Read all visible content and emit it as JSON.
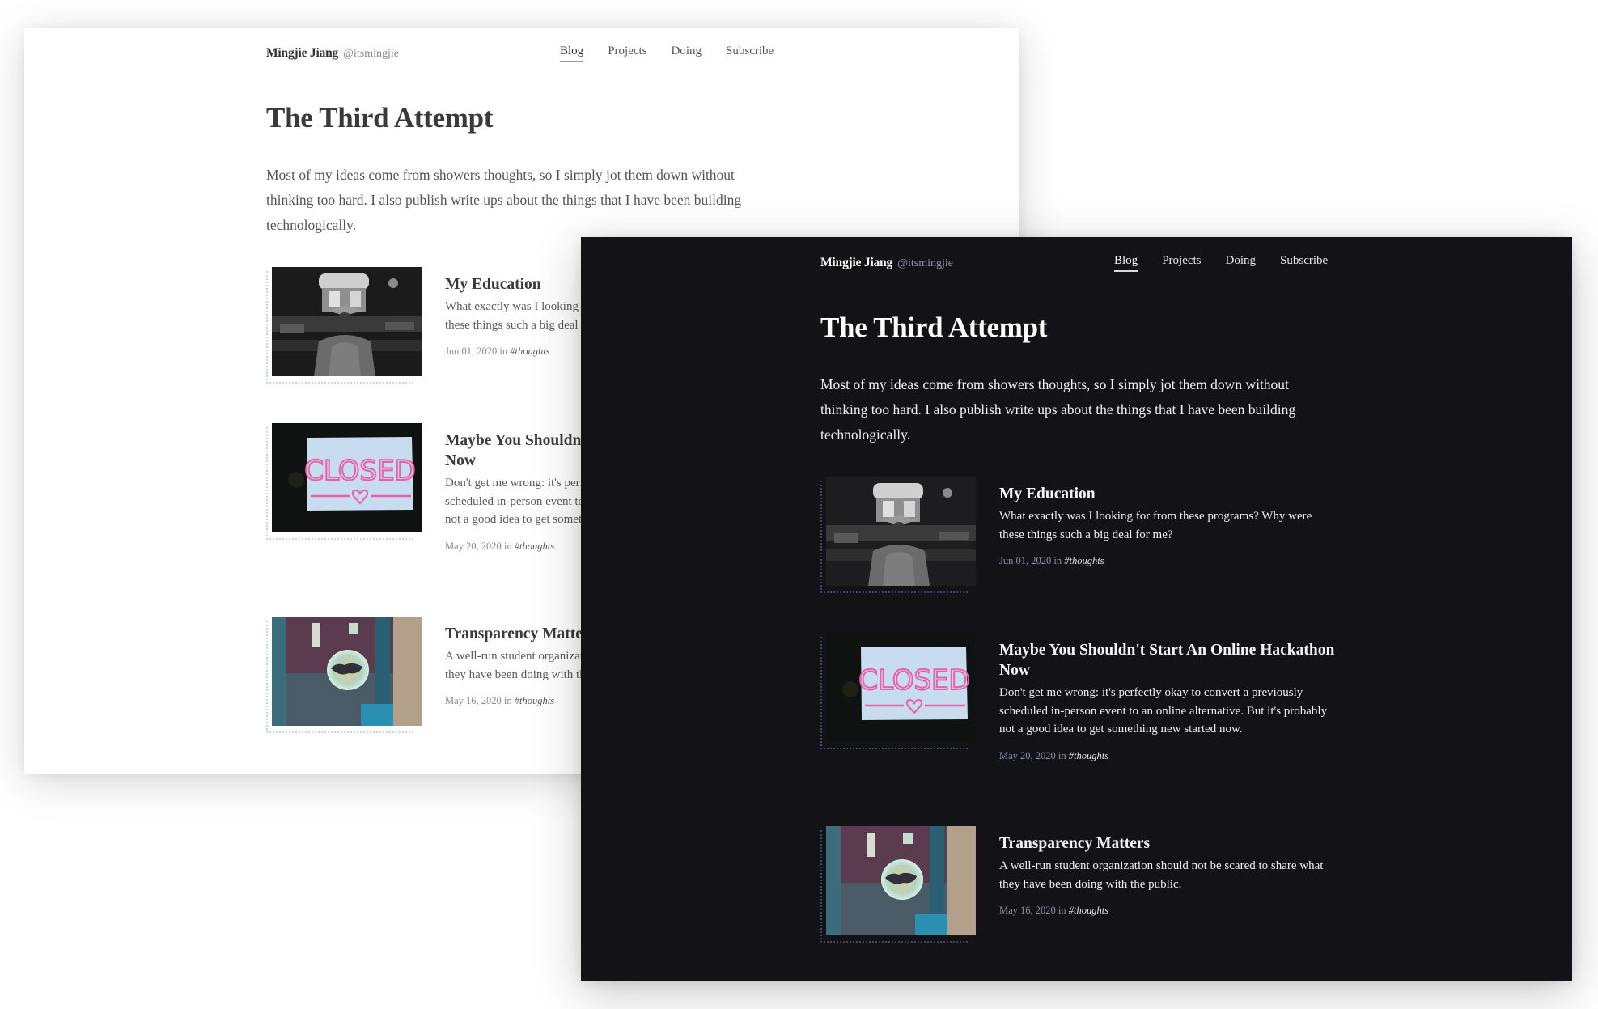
{
  "site": {
    "brand_name": "Mingjie Jiang",
    "brand_handle": "@itsmingjie",
    "nav": [
      {
        "label": "Blog",
        "active": true
      },
      {
        "label": "Projects",
        "active": false
      },
      {
        "label": "Doing",
        "active": false
      },
      {
        "label": "Subscribe",
        "active": false
      }
    ],
    "page_title": "The Third Attempt",
    "intro": "Most of my ideas come from showers thoughts, so I simply jot them down without thinking too hard. I also publish write ups about the things that I have been building technologically.",
    "posts": [
      {
        "title": "My Education",
        "excerpt": "What exactly was I looking for from these programs? Why were these things such a big deal for me?",
        "date": "Jun 01, 2020",
        "in_label": "in",
        "tag": "#thoughts",
        "image": "graduation-photo"
      },
      {
        "title": "Maybe You Shouldn't Start An Online Hackathon Now",
        "excerpt": "Don't get me wrong: it's perfectly okay to convert a previously scheduled in-person event to an online alternative. But it's probably not a good idea to get something new started now.",
        "date": "May 20, 2020",
        "in_label": "in",
        "tag": "#thoughts",
        "image": "closed-sign-photo",
        "image_text": "CLOSED"
      },
      {
        "title": "Transparency Matters",
        "excerpt": "A well-run student organization should not be scared to share what they have been doing with the public.",
        "date": "May 16, 2020",
        "in_label": "in",
        "tag": "#thoughts",
        "image": "bubble-photo"
      }
    ]
  },
  "themes": {
    "light": {
      "background": "#ffffff",
      "text": "#3a3a3a",
      "muted": "#8a8a8a"
    },
    "dark": {
      "background": "#131217",
      "text": "#ffffff",
      "muted": "#8a93a8"
    }
  }
}
